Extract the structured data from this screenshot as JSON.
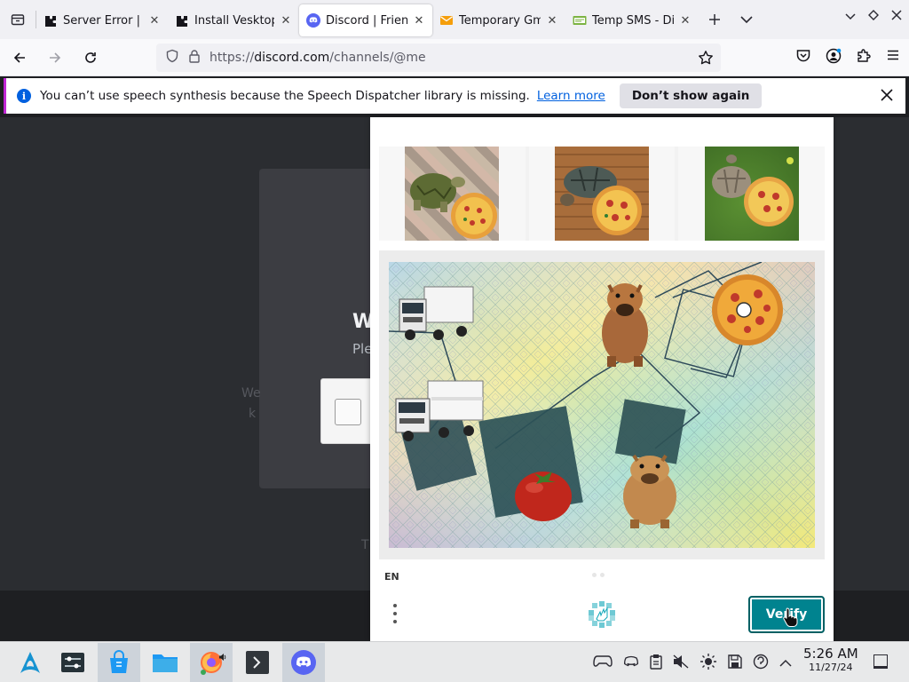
{
  "tabs": [
    {
      "title": "Server Error | H",
      "favicon": "puzzle-icon",
      "active": false
    },
    {
      "title": "Install Vesktop",
      "favicon": "puzzle-icon",
      "active": false
    },
    {
      "title": "Discord | Frien",
      "favicon": "discord-icon",
      "active": true
    },
    {
      "title": "Temporary Gm",
      "favicon": "envelope-icon",
      "active": false
    },
    {
      "title": "Temp SMS - Dis",
      "favicon": "sms-icon",
      "active": false
    }
  ],
  "tab_close_glyph": "✕",
  "url": {
    "scheme": "https://",
    "host": "discord.com",
    "path": "/channels/@me"
  },
  "notification": {
    "message": "You can’t use speech synthesis because the Speech Dispatcher library is missing.",
    "learn_more": "Learn more",
    "dont_show": "Don’t show again"
  },
  "discord": {
    "heading": "W",
    "subheading": "Ple",
    "faint_line_1": "We",
    "faint_line_2": "k",
    "faint_t": "T"
  },
  "captcha": {
    "language": "EN",
    "verify_label": "Verify",
    "brand_color": "#00838f",
    "reference_images": [
      "turtle-with-pizza-on-tiles",
      "turtle-with-pizza-on-wood",
      "turtle-with-pizza-on-grass"
    ],
    "challenge_objects": [
      "truck",
      "truck",
      "capybara",
      "capybara",
      "pizza",
      "tomato"
    ]
  },
  "taskbar": {
    "apps": [
      "app-launcher",
      "system-settings",
      "discover-store",
      "file-manager",
      "firefox",
      "terminal",
      "discord"
    ],
    "time": "5:26 AM",
    "date": "11/27/24"
  }
}
